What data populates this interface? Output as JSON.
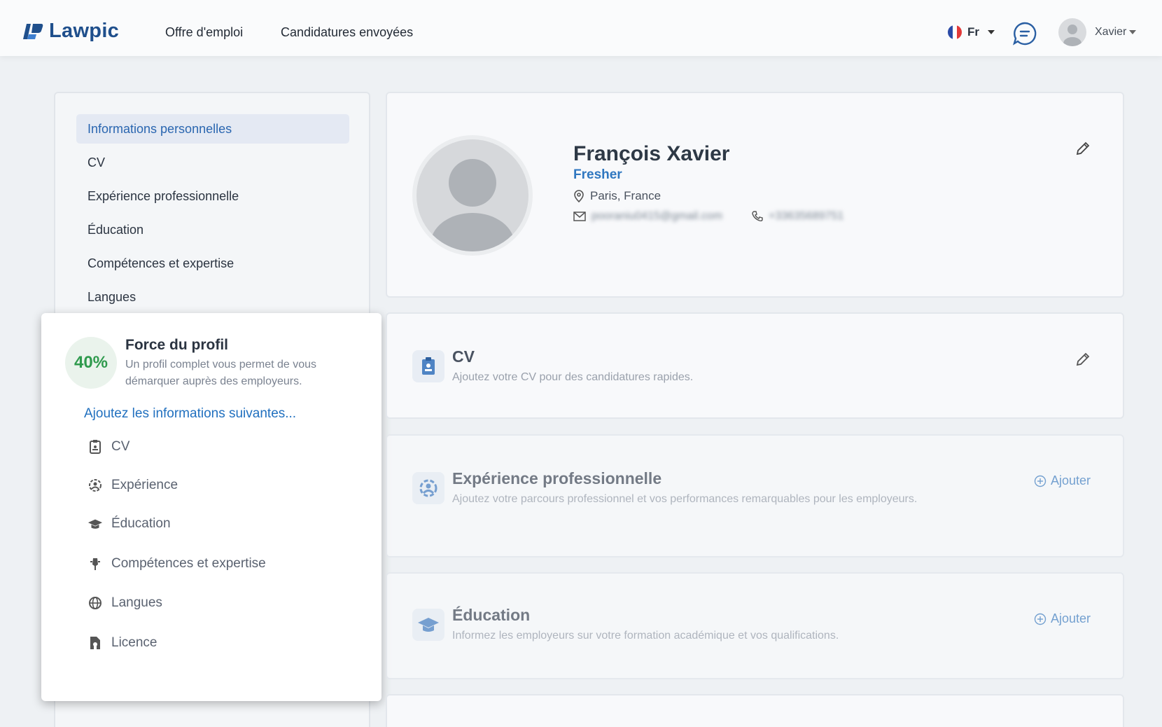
{
  "header": {
    "brand": "Lawpic",
    "nav": [
      "Offre d'emploi",
      "Candidatures envoyées"
    ],
    "language": "Fr",
    "user_name": "Xavier"
  },
  "sidebar": {
    "items": [
      {
        "label": "Informations personnelles",
        "active": true
      },
      {
        "label": "CV",
        "active": false
      },
      {
        "label": "Expérience professionnelle",
        "active": false
      },
      {
        "label": "Éducation",
        "active": false
      },
      {
        "label": "Compétences et expertise",
        "active": false
      },
      {
        "label": "Langues",
        "active": false
      }
    ]
  },
  "strength": {
    "percent": "40%",
    "title": "Force du profil",
    "subtitle": "Un profil complet vous permet de vous démarquer auprès des employeurs.",
    "link": "Ajoutez les informations suivantes...",
    "items": [
      {
        "label": "CV",
        "icon": "cv-icon"
      },
      {
        "label": "Expérience",
        "icon": "experience-icon"
      },
      {
        "label": "Éducation",
        "icon": "graduation-cap-icon"
      },
      {
        "label": "Compétences et expertise",
        "icon": "skills-icon"
      },
      {
        "label": "Langues",
        "icon": "globe-icon"
      },
      {
        "label": "Licence",
        "icon": "license-icon"
      }
    ]
  },
  "profile": {
    "name": "François Xavier",
    "title": "Fresher",
    "location": "Paris, France",
    "email": "pooraniu0415@gmail.com",
    "phone": "+33635689751"
  },
  "sections": {
    "cv": {
      "title": "CV",
      "subtitle": "Ajoutez votre CV pour des candidatures rapides."
    },
    "experience": {
      "title": "Expérience professionnelle",
      "subtitle": "Ajoutez votre parcours professionnel et vos performances remarquables pour les employeurs.",
      "action": "Ajouter"
    },
    "education": {
      "title": "Éducation",
      "subtitle": "Informez les employeurs sur votre formation académique et vos qualifications.",
      "action": "Ajouter"
    }
  },
  "colors": {
    "brand": "#1f4f8c",
    "accent": "#2170bf",
    "success": "#2f9a4d"
  }
}
